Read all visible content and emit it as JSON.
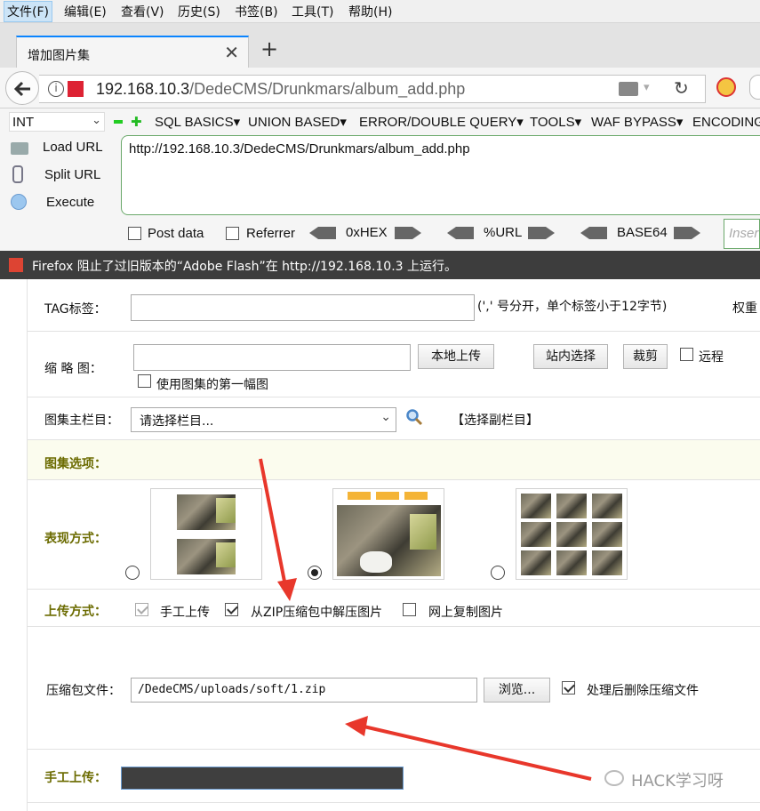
{
  "menubar": {
    "items": [
      "文件(F)",
      "编辑(E)",
      "查看(V)",
      "历史(S)",
      "书签(B)",
      "工具(T)",
      "帮助(H)"
    ]
  },
  "tab": {
    "title": "增加图片集",
    "close": "✕",
    "new": "+"
  },
  "navbar": {
    "url_host": "192.168.10.3",
    "url_path": "/DedeCMS/Drunkmars/album_add.php"
  },
  "hackbar": {
    "select_value": "INT",
    "menus": [
      "SQL BASICS▾",
      "UNION BASED▾",
      "ERROR/DOUBLE QUERY▾",
      "TOOLS▾",
      "WAF BYPASS▾",
      "ENCODING▾"
    ],
    "load_url": "Load URL",
    "split_url": "Split URL",
    "execute": "Execute",
    "url_value": "http://192.168.10.3/DedeCMS/Drunkmars/album_add.php",
    "post_data": "Post data",
    "referrer": "Referrer",
    "hex": "0xHEX",
    "urlenc": "%URL",
    "base64": "BASE64",
    "insert_placeholder": "Inser"
  },
  "flash": {
    "text": "Firefox 阻止了过旧版本的“Adobe Flash”在 http://192.168.10.3 上运行。"
  },
  "form": {
    "tag_label": "TAG标签：",
    "tag_hint": "(',' 号分开，单个标签小于12字节)",
    "weight_label": "权重",
    "thumb_label": "缩 略 图：",
    "local_upload": "本地上传",
    "site_select": "站内选择",
    "crop": "裁剪",
    "remote": "远程",
    "use_first": "使用图集的第一幅图",
    "column_label": "图集主栏目：",
    "column_select": "请选择栏目...",
    "sub_column": "【选择副栏目】",
    "options_label": "图集选项：",
    "display_label": "表现方式：",
    "upload_mode_label": "上传方式：",
    "manual_upload": "手工上传",
    "zip_upload": "从ZIP压缩包中解压图片",
    "net_copy": "网上复制图片",
    "zip_file_label": "压缩包文件：",
    "zip_path": "/DedeCMS/uploads/soft/1.zip",
    "browse": "浏览...",
    "delete_after": "处理后删除压缩文件",
    "manual_label": "手工上传："
  },
  "watermark": {
    "text": "HACK学习呀"
  },
  "colors": {
    "accent": "#0a84ff",
    "olive": "#6b6b00",
    "arrow_red": "#e8372b"
  }
}
